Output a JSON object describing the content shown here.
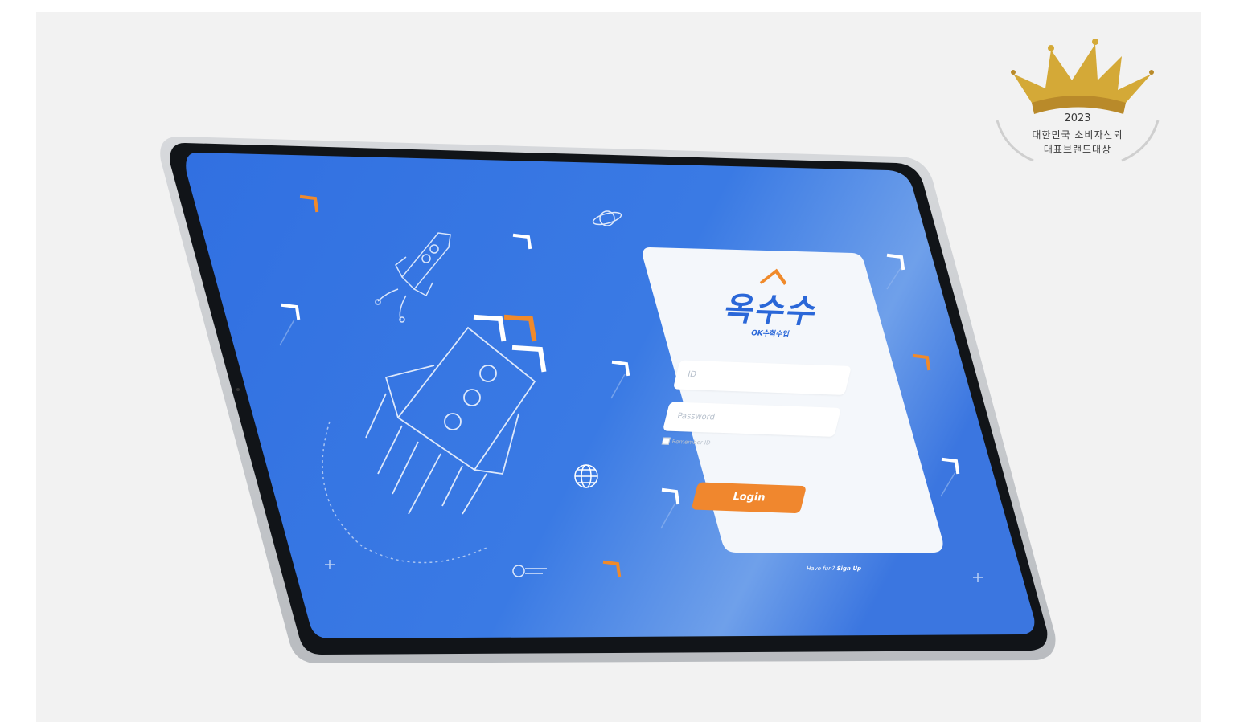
{
  "login": {
    "logo_text": "옥수수",
    "logo_subtitle": "OK수학수업",
    "id_placeholder": "ID",
    "password_placeholder": "Password",
    "remember_label": "Remember ID",
    "login_button": "Login",
    "signup_prompt": "Have fun?",
    "signup_link": "Sign Up"
  },
  "award": {
    "year": "2023",
    "line1": "대한민국 소비자신뢰",
    "line2": "대표브랜드대상"
  },
  "colors": {
    "screen_blue": "#3372e2",
    "accent_orange": "#f08a2b",
    "logo_blue": "#2a67d8",
    "award_gold": "#d4a937"
  }
}
